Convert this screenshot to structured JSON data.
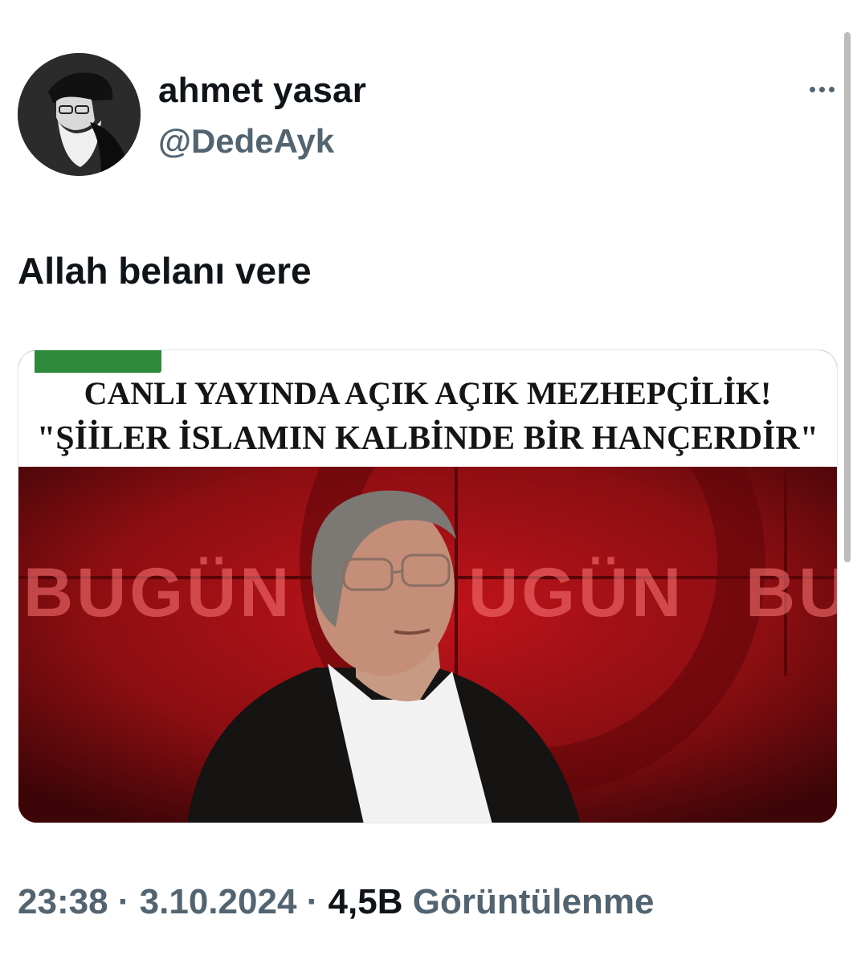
{
  "user": {
    "display_name": "ahmet yasar",
    "handle": "@DedeAyk"
  },
  "tweet": {
    "text": "Allah belanı vere",
    "meta": {
      "time": "23:38",
      "date": "3.10.2024",
      "views_count": "4,5B",
      "views_label": "Görüntülenme",
      "separator": "·"
    }
  },
  "media": {
    "headline_line1": "CANLI YAYINDA AÇIK AÇIK MEZHEPÇİLİK!",
    "headline_line2": "\"ŞİİLER İSLAMIN KALBİNDE BİR HANÇERDİR\"",
    "background_text_1": "BUGÜN",
    "background_text_2": "UGÜN",
    "background_text_3": "BU"
  },
  "colors": {
    "primary_text": "#0f1419",
    "secondary_text": "#536471",
    "studio_red": "#8b0e12",
    "channel_green": "#2e8a3a"
  },
  "icons": {
    "more": "more-horizontal-icon"
  }
}
